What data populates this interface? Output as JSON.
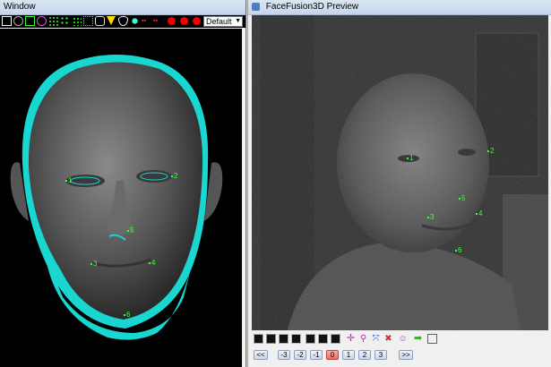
{
  "left_window": {
    "title": "Window",
    "preset": {
      "value": "Default"
    },
    "toolbar_icons": [
      "select-icon",
      "crop-icon",
      "rect-icon",
      "target-icon",
      "scatter-icon",
      "mesh-icon",
      "mesh2-icon",
      "grid-icon",
      "lasso-icon",
      "cone-icon",
      "eye-icon",
      "tree-icon",
      "red-mark-icon",
      "red-mark2-icon",
      "record-icon",
      "record2-icon",
      "record3-icon"
    ],
    "landmarks": [
      {
        "label": "1",
        "name": "landmark-1"
      },
      {
        "label": "2",
        "name": "landmark-2"
      },
      {
        "label": "5",
        "name": "landmark-5"
      },
      {
        "label": "3",
        "name": "landmark-3"
      },
      {
        "label": "4",
        "name": "landmark-4"
      },
      {
        "label": "6",
        "name": "landmark-6"
      }
    ]
  },
  "right_window": {
    "title": "FaceFusion3D Preview",
    "landmarks": [
      {
        "label": "1"
      },
      {
        "label": "2"
      },
      {
        "label": "5"
      },
      {
        "label": "3"
      },
      {
        "label": "4"
      },
      {
        "label": "6"
      }
    ],
    "nav": {
      "prev": "<<",
      "next": ">>",
      "pages": [
        "-3",
        "-2",
        "-1",
        "0",
        "1",
        "2",
        "3"
      ],
      "active": "0"
    }
  },
  "colors": {
    "mesh_cyan": "#19d6d1",
    "landmark_green": "#39ff39",
    "active_page": "#ff6060"
  }
}
